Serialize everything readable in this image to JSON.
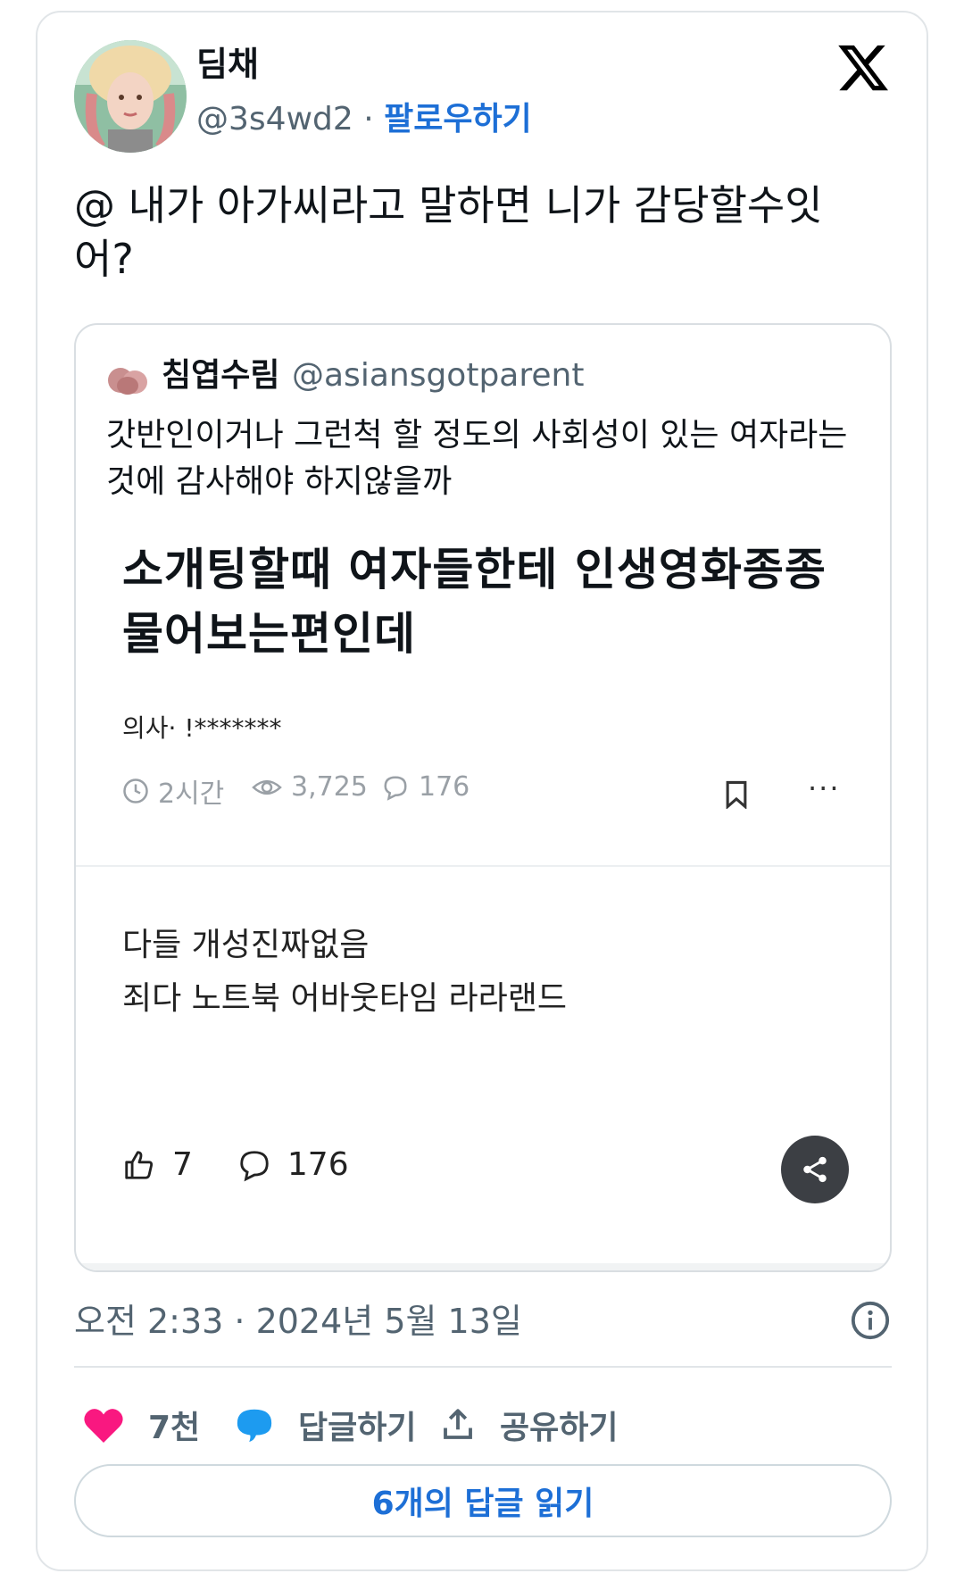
{
  "tweet": {
    "display_name": "딤채",
    "handle": "@3s4wd2",
    "separator": "·",
    "follow_label": "팔로우하기",
    "text": "@ 내가 아가씨라고 말하면 니가 감당할수잇어?",
    "timestamp": "오전 2:33 · 2024년 5월 13일",
    "likes": "7천",
    "reply_label": "답글하기",
    "share_label": "공유하기",
    "read_replies_label": "6개의 답글 읽기"
  },
  "quoted": {
    "display_name": "침엽수림",
    "handle": "@asiansgotparent",
    "text": "갓반인이거나 그런척 할 정도의 사회성이 있는 여자라는 것에 감사해야 하지않을까",
    "post": {
      "title": "소개팅할때 여자들한테 인생영화종종 물어보는편인데",
      "author": "의사· !*******",
      "time": "2시간",
      "views": "3,725",
      "comments": "176",
      "more": "···",
      "body_line_1": "다들 개성진짜없음",
      "body_line_2": "죄다 노트북 어바웃타임 라라랜드",
      "likes": "7",
      "comment_count": "176"
    }
  },
  "colors": {
    "accent": "#1d6fd6",
    "like_heart": "#f91880",
    "reply_bubble": "#1d9bf0",
    "muted_text": "#536471"
  },
  "icons": [
    "x-logo-icon",
    "clock-icon",
    "eye-icon",
    "comment-icon",
    "bookmark-icon",
    "thumbs-up-icon",
    "share-icon",
    "info-icon",
    "heart-icon",
    "reply-icon",
    "upload-icon"
  ]
}
